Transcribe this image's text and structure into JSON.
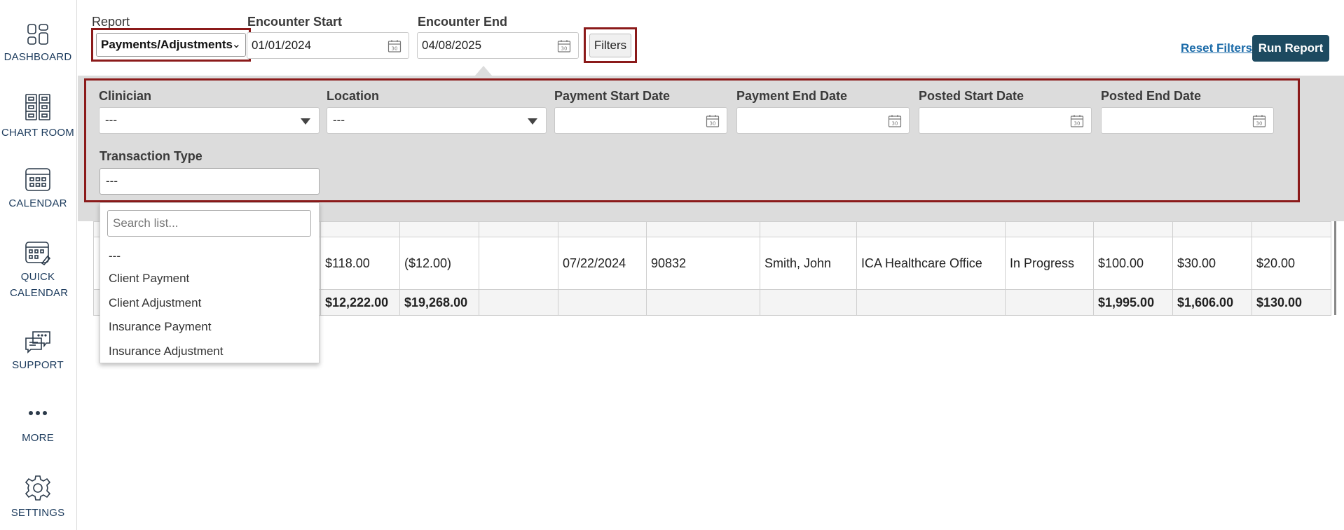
{
  "sidebar": {
    "items": [
      {
        "label": "DASHBOARD",
        "icon": "dashboard-icon"
      },
      {
        "label": "CHART ROOM",
        "icon": "file-cabinet-icon"
      },
      {
        "label": "CALENDAR",
        "icon": "calendar-icon"
      },
      {
        "label": "QUICK CALENDAR",
        "icon": "quick-calendar-icon"
      },
      {
        "label": "SUPPORT",
        "icon": "chat-bubbles-icon"
      },
      {
        "label": "MORE",
        "icon": "ellipsis-icon"
      },
      {
        "label": "SETTINGS",
        "icon": "gear-icon"
      }
    ]
  },
  "topbar": {
    "report_label": "Report",
    "report_value": "Payments/Adjustments",
    "encounter_start_label": "Encounter Start",
    "encounter_start_value": "01/01/2024",
    "encounter_end_label": "Encounter End",
    "encounter_end_value": "04/08/2025",
    "filters_label": "Filters",
    "reset_label": "Reset Filters",
    "run_label": "Run Report"
  },
  "filters": {
    "clinician_label": "Clinician",
    "clinician_value": "---",
    "location_label": "Location",
    "location_value": "---",
    "payment_start_label": "Payment Start Date",
    "payment_end_label": "Payment End Date",
    "posted_start_label": "Posted Start Date",
    "posted_end_label": "Posted End Date",
    "transaction_type_label": "Transaction Type",
    "transaction_type_value": "---"
  },
  "dropdown": {
    "search_placeholder": "Search list...",
    "options": [
      "---",
      "Client Payment",
      "Client Adjustment",
      "Insurance Payment",
      "Insurance Adjustment"
    ]
  },
  "table": {
    "data_row": [
      "",
      "$118.00",
      "($12.00)",
      "",
      "07/22/2024",
      "90832",
      "Smith, John",
      "ICA Healthcare Office",
      "In Progress",
      "$100.00",
      "$30.00",
      "$20.00"
    ],
    "total_row": [
      "",
      "$12,222.00",
      "$19,268.00",
      "",
      "",
      "",
      "",
      "",
      "",
      "$1,995.00",
      "$1,606.00",
      "$130.00"
    ]
  },
  "colors": {
    "highlight_border": "#8b1a1a",
    "nav_text": "#1b3a5c",
    "run_button": "#1d4a60",
    "link": "#1a6aa8",
    "panel_bg": "#dcdcdc"
  }
}
